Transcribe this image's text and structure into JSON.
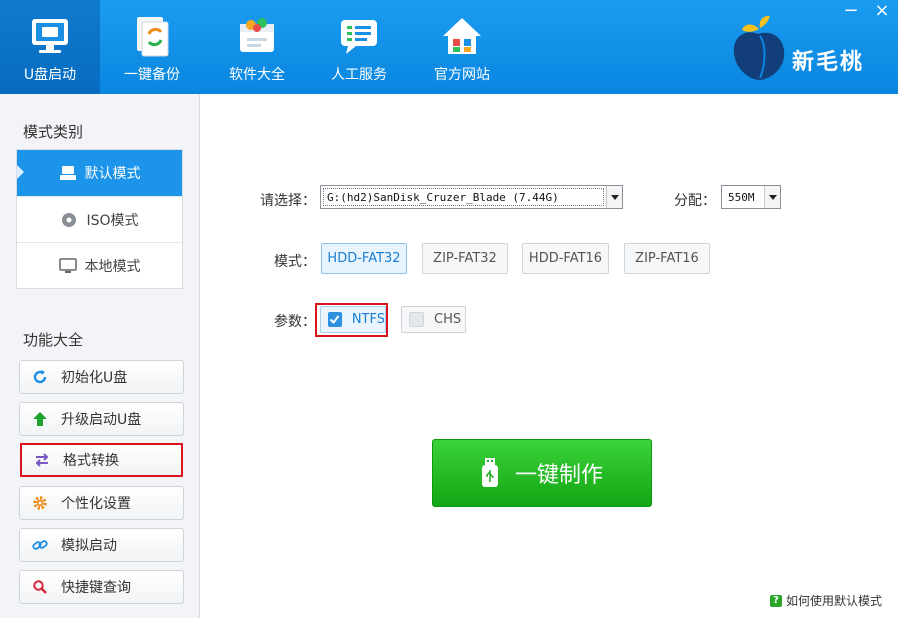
{
  "topbar": {
    "nav": [
      {
        "label": "U盘启动",
        "icon": "monitor-usb-icon"
      },
      {
        "label": "一键备份",
        "icon": "backup-document-icon"
      },
      {
        "label": "软件大全",
        "icon": "software-box-icon"
      },
      {
        "label": "人工服务",
        "icon": "chat-service-icon"
      },
      {
        "label": "官方网站",
        "icon": "home-icon"
      }
    ],
    "minimize": "−",
    "close": "×",
    "logo_text": "新毛桃"
  },
  "sidebar": {
    "mode_title": "模式类别",
    "modes": [
      {
        "label": "默认模式",
        "icon": "usb-drive-icon"
      },
      {
        "label": "ISO模式",
        "icon": "disc-icon"
      },
      {
        "label": "本地模式",
        "icon": "monitor-icon"
      }
    ],
    "func_title": "功能大全",
    "functions": [
      {
        "label": "初始化U盘",
        "icon": "refresh-icon"
      },
      {
        "label": "升级启动U盘",
        "icon": "upgrade-arrow-icon"
      },
      {
        "label": "格式转换",
        "icon": "convert-arrows-icon"
      },
      {
        "label": "个性化设置",
        "icon": "gear-icon"
      },
      {
        "label": "模拟启动",
        "icon": "link-icon"
      },
      {
        "label": "快捷键查询",
        "icon": "search-icon"
      }
    ]
  },
  "main": {
    "select_label": "请选择：",
    "device": "G:(hd2)SanDisk_Cruzer_Blade (7.44G)",
    "alloc_label": "分配：",
    "alloc_value": "550M",
    "mode_label": "模式：",
    "formats": [
      "HDD-FAT32",
      "ZIP-FAT32",
      "HDD-FAT16",
      "ZIP-FAT16"
    ],
    "param_label": "参数：",
    "params": [
      {
        "label": "NTFS",
        "checked": true
      },
      {
        "label": "CHS",
        "checked": false
      }
    ],
    "make_button": "一键制作",
    "help_q": "?",
    "help_text": "如何使用默认模式"
  },
  "colors": {
    "header_blue": "#0a86e0",
    "accent_blue": "#1b94ea",
    "make_green": "#14a614",
    "highlight_red": "#d9121d"
  }
}
